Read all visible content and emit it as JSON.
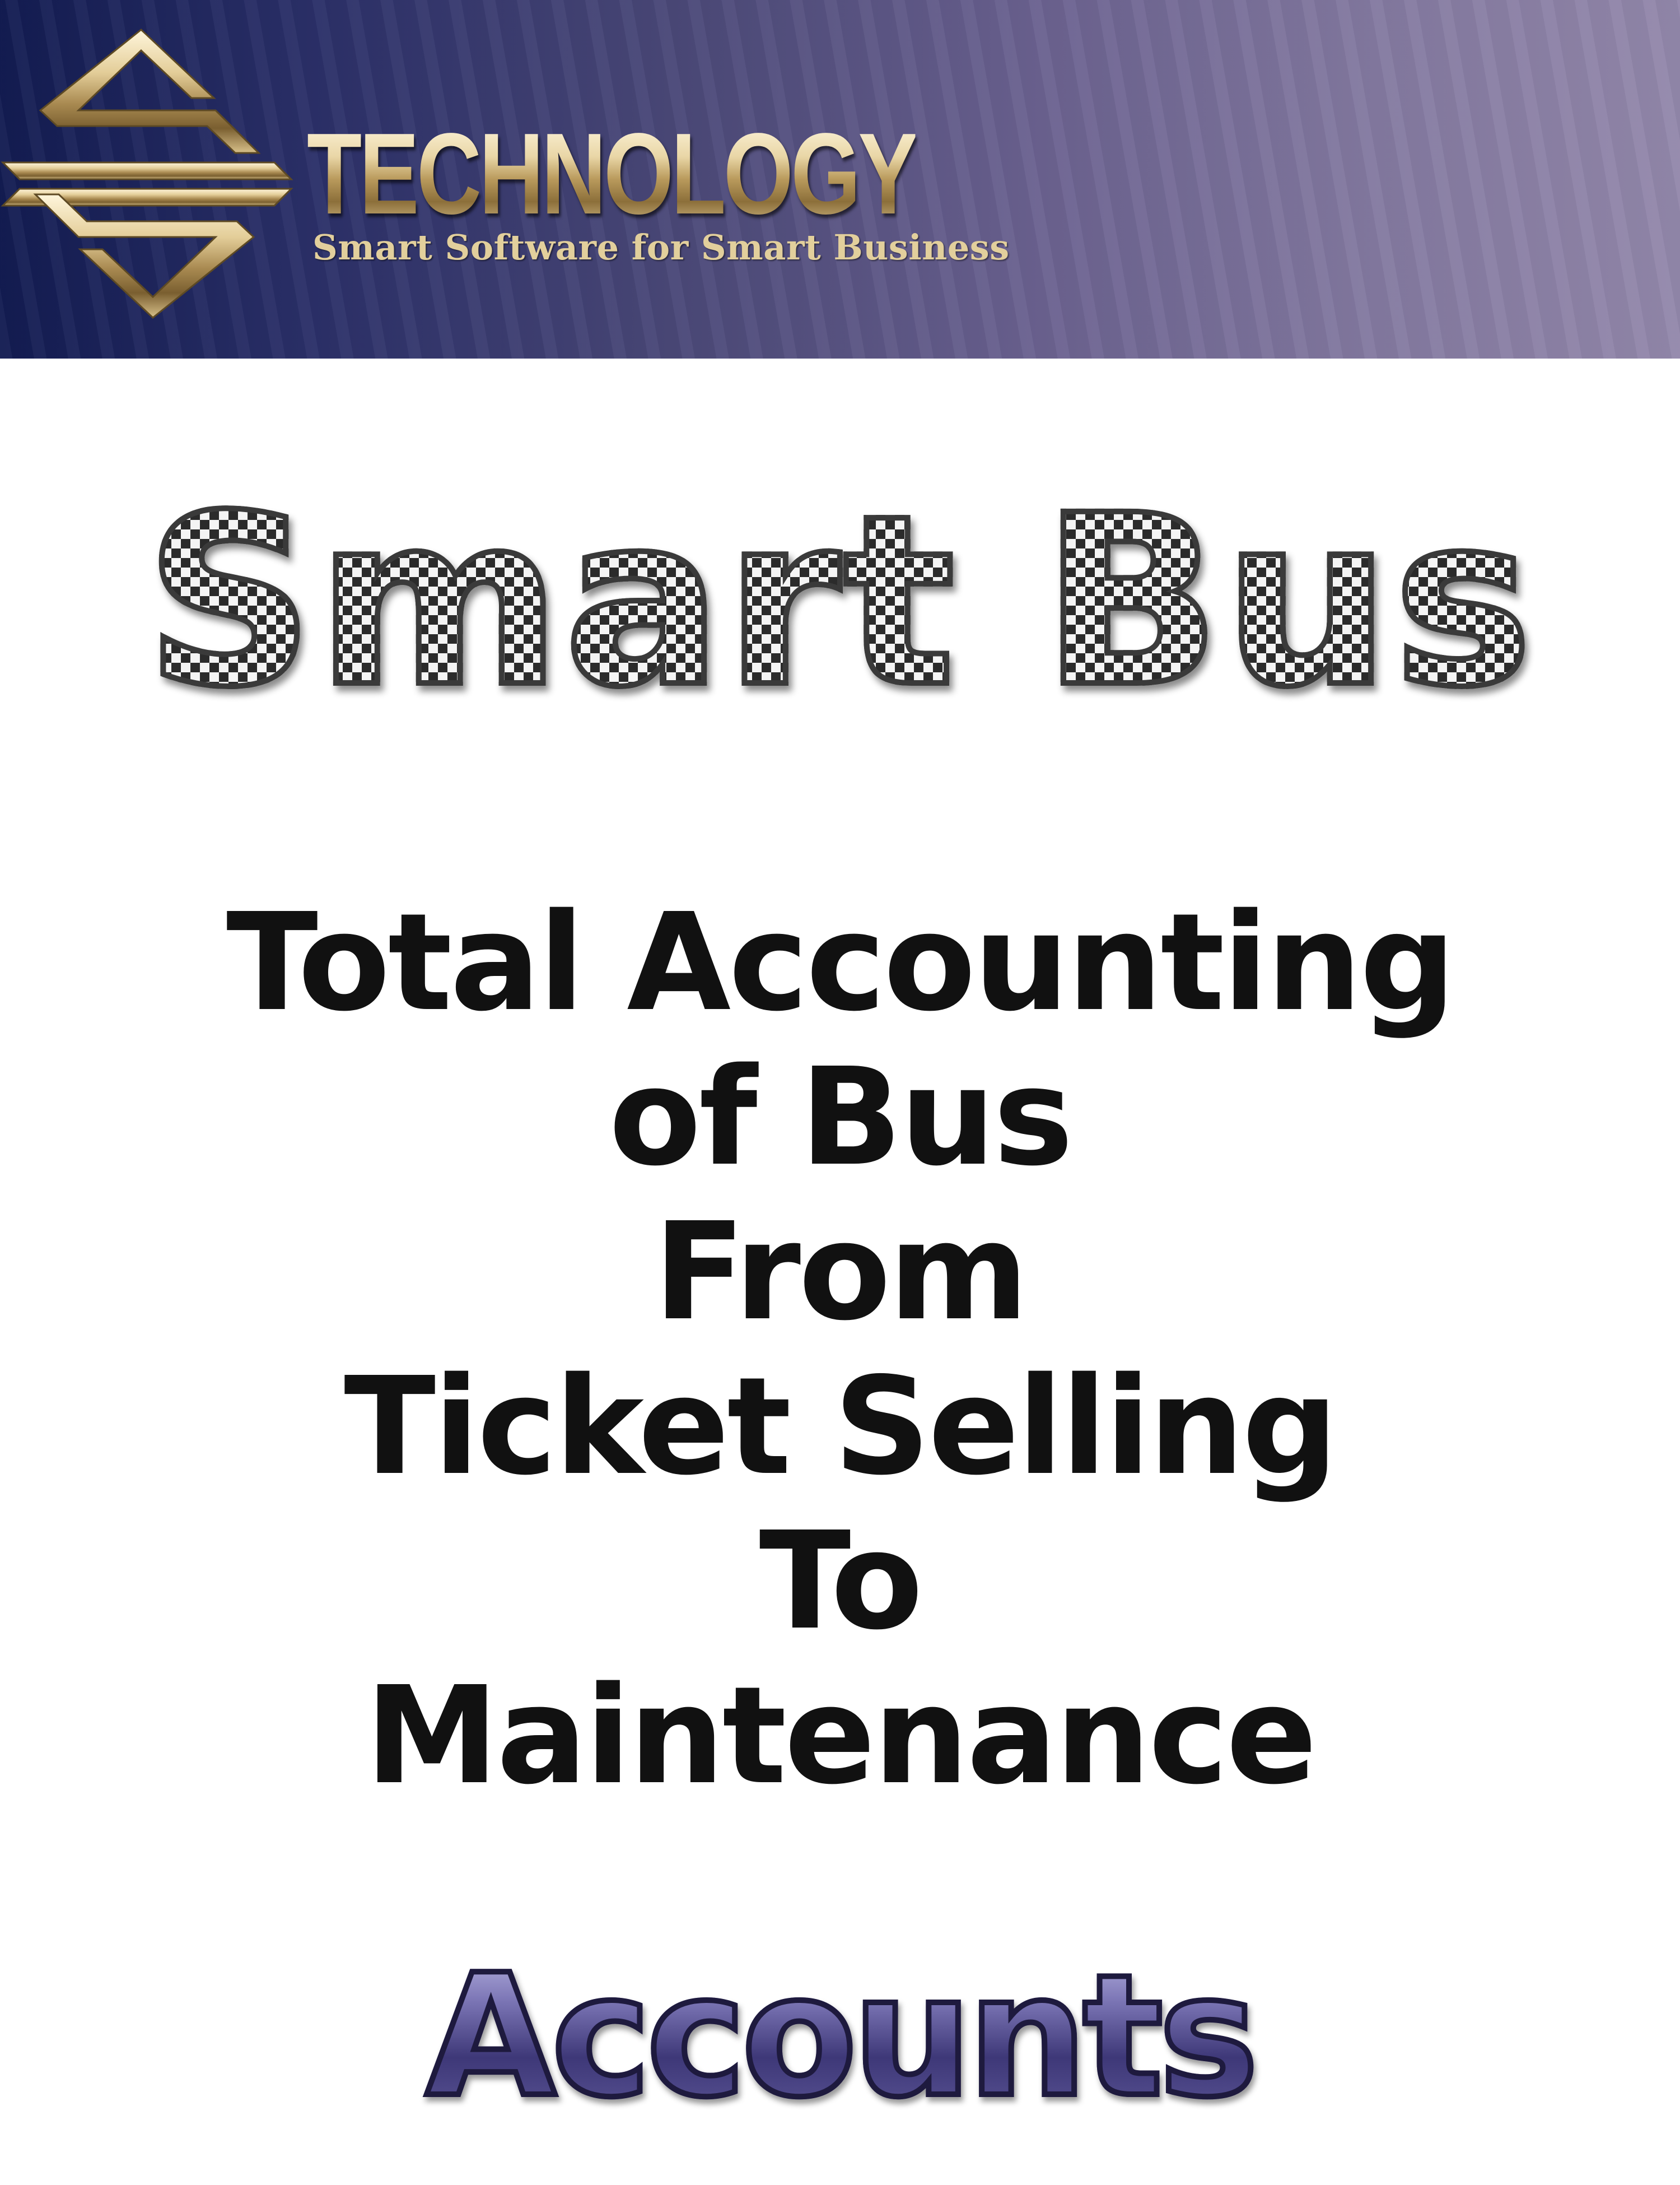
{
  "header": {
    "brand": "TECHNOLOGY",
    "tagline": "Smart Software for Smart Business",
    "logo_icon": "s-diamond-logo-icon",
    "colors": {
      "banner_dark": "#131c52",
      "banner_light": "#9388ab",
      "gold": "#c9ad74"
    }
  },
  "product": {
    "title": "Smart Bus"
  },
  "description": {
    "lines": [
      "Total Accounting",
      "of Bus",
      "From",
      "Ticket Selling",
      "To",
      "Maintenance"
    ]
  },
  "section": {
    "label": "Accounts",
    "color": "#4a4486"
  }
}
